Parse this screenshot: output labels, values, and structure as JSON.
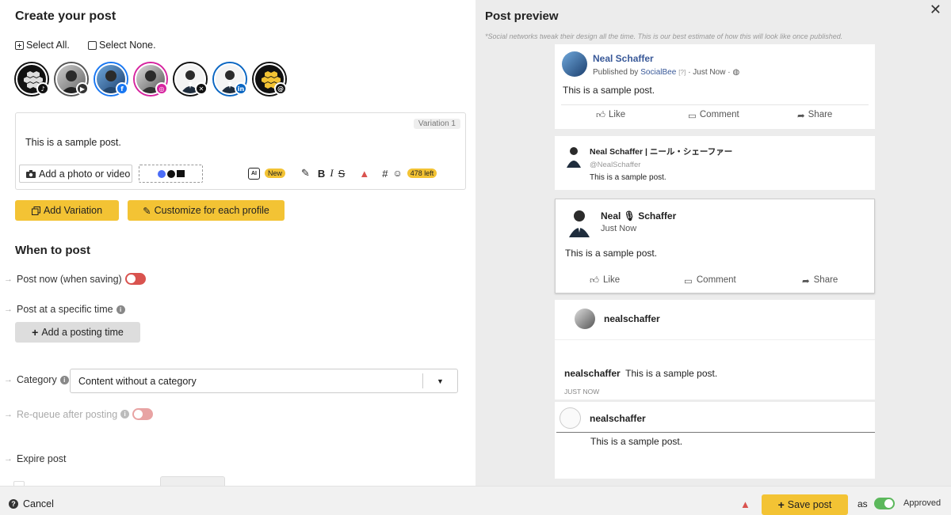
{
  "left": {
    "title": "Create your post",
    "select_all": "Select All.",
    "select_none": "Select None.",
    "profiles": [
      {
        "network": "tiktok",
        "badge_color": "#111111",
        "glyph": "♪"
      },
      {
        "network": "youtube",
        "badge_color": "#333333",
        "glyph": "▶"
      },
      {
        "network": "facebook",
        "badge_color": "#1877f2",
        "glyph": "f"
      },
      {
        "network": "instagram",
        "badge_color": "#d6249f",
        "glyph": "◎"
      },
      {
        "network": "x",
        "badge_color": "#111111",
        "glyph": "✕"
      },
      {
        "network": "linkedin",
        "badge_color": "#0a66c2",
        "glyph": "in"
      },
      {
        "network": "threads",
        "badge_color": "#111111",
        "glyph": "@"
      }
    ],
    "variation_label": "Variation 1",
    "post_text": "This is a sample post.",
    "add_media": "Add a photo or video",
    "ai_new": "New",
    "chars_left": "478 left",
    "add_variation": "Add Variation",
    "customize": "Customize for each profile",
    "when_title": "When to post",
    "post_now": "Post now (when saving)",
    "post_specific": "Post at a specific time",
    "add_posting_time": "Add a posting time",
    "category_label": "Category",
    "category_value": "Content without a category",
    "requeue": "Re-queue after posting",
    "expire": "Expire post"
  },
  "preview": {
    "title": "Post preview",
    "note": "*Social networks tweak their design all the time. This is our best estimate of how this will look like once published.",
    "fb": {
      "name": "Neal Schaffer",
      "published_by": "Published by",
      "via": "SocialBee",
      "q": "[?]",
      "time": "· Just Now ·",
      "text": "This is a sample post.",
      "like": "Like",
      "comment": "Comment",
      "share": "Share"
    },
    "x": {
      "name": "Neal Schaffer | ニール・シェーファー",
      "handle": "@NealSchaffer",
      "text": "This is a sample post."
    },
    "li": {
      "name": "Neal 🎙 Schaffer",
      "time": "Just Now",
      "text": "This is a sample post.",
      "like": "Like",
      "comment": "Comment",
      "share": "Share"
    },
    "ig": {
      "name": "nealschaffer",
      "caption_user": "nealschaffer",
      "caption": "This is a sample post.",
      "time": "JUST NOW"
    },
    "th": {
      "name": "nealschaffer",
      "text": "This is a sample post."
    }
  },
  "footer": {
    "cancel": "Cancel",
    "save": "Save post",
    "as": "as",
    "approved": "Approved"
  },
  "colors": {
    "accent": "#f3c334",
    "toggle_red": "#d9534f",
    "toggle_green": "#5cb85c",
    "fb_blue": "#385898"
  }
}
